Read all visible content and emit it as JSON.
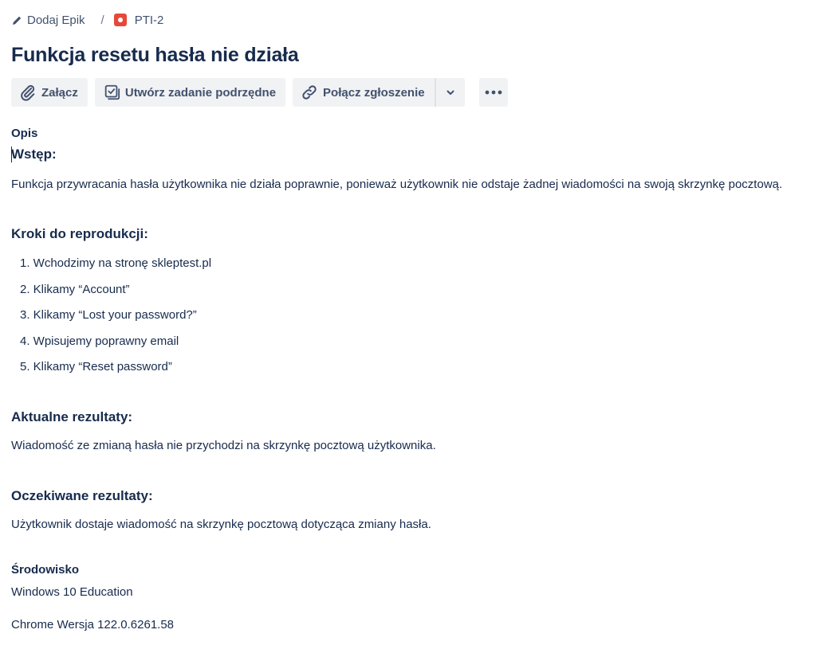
{
  "breadcrumb": {
    "epic_label": "Dodaj Epik",
    "separator": "/",
    "issue_key": "PTI-2"
  },
  "issue": {
    "title": "Funkcja resetu hasła nie działa"
  },
  "toolbar": {
    "attach_label": "Załącz",
    "subtask_label": "Utwórz zadanie podrzędne",
    "link_label": "Połącz zgłoszenie"
  },
  "icons": {
    "edit": "pencil-icon",
    "issue_type": "bug-icon",
    "attach": "paperclip-icon",
    "subtask": "subtask-checkbox-icon",
    "link": "link-icon",
    "dropdown": "chevron-down-icon",
    "more": "more-dots-icon",
    "issue_type_color": "#e5493a"
  },
  "description": {
    "label": "Opis",
    "intro_heading": "Wstęp:",
    "intro_text": "Funkcja przywracania hasła użytkownika nie działa poprawnie, ponieważ użytkownik nie odstaje żadnej wiadomości na swoją skrzynkę pocztową.",
    "steps_heading": "Kroki do reprodukcji:",
    "steps": [
      "1. Wchodzimy na stronę skleptest.pl",
      "2. Klikamy “Account”",
      "3. Klikamy “Lost your password?”",
      "4. Wpisujemy poprawny email",
      "5. Klikamy “Reset password”"
    ],
    "actual_heading": "Aktualne rezultaty:",
    "actual_text": "Wiadomość ze zmianą hasła nie przychodzi na skrzynkę pocztową użytkownika.",
    "expected_heading": "Oczekiwane rezultaty:",
    "expected_text": "Użytkownik dostaje wiadomość na skrzynkę pocztową dotycząca zmiany hasła."
  },
  "environment": {
    "label": "Środowisko",
    "line1": "Windows 10 Education",
    "line2": "Chrome Wersja 122.0.6261.58"
  }
}
